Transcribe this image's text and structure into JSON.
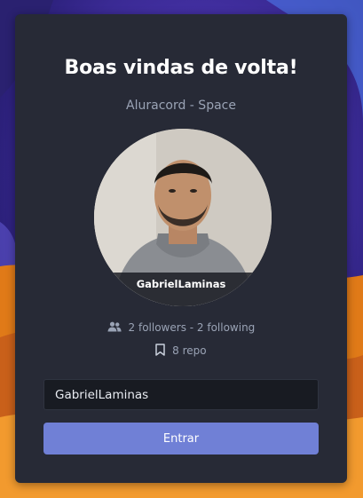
{
  "colors": {
    "card_background": "#272a36",
    "accent_button": "#7080d6",
    "background_purple": "#3a2d8f",
    "background_orange": "#e8821c"
  },
  "header": {
    "title": "Boas vindas de volta!",
    "subtitle": "Aluracord - Space"
  },
  "profile": {
    "username": "GabrielLaminas",
    "followers_icon": "people-icon",
    "followers_text": "2 followers - 2 following",
    "repo_icon": "bookmark-icon",
    "repo_text": "8 repo"
  },
  "form": {
    "username_value": "GabrielLaminas",
    "submit_label": "Entrar"
  }
}
